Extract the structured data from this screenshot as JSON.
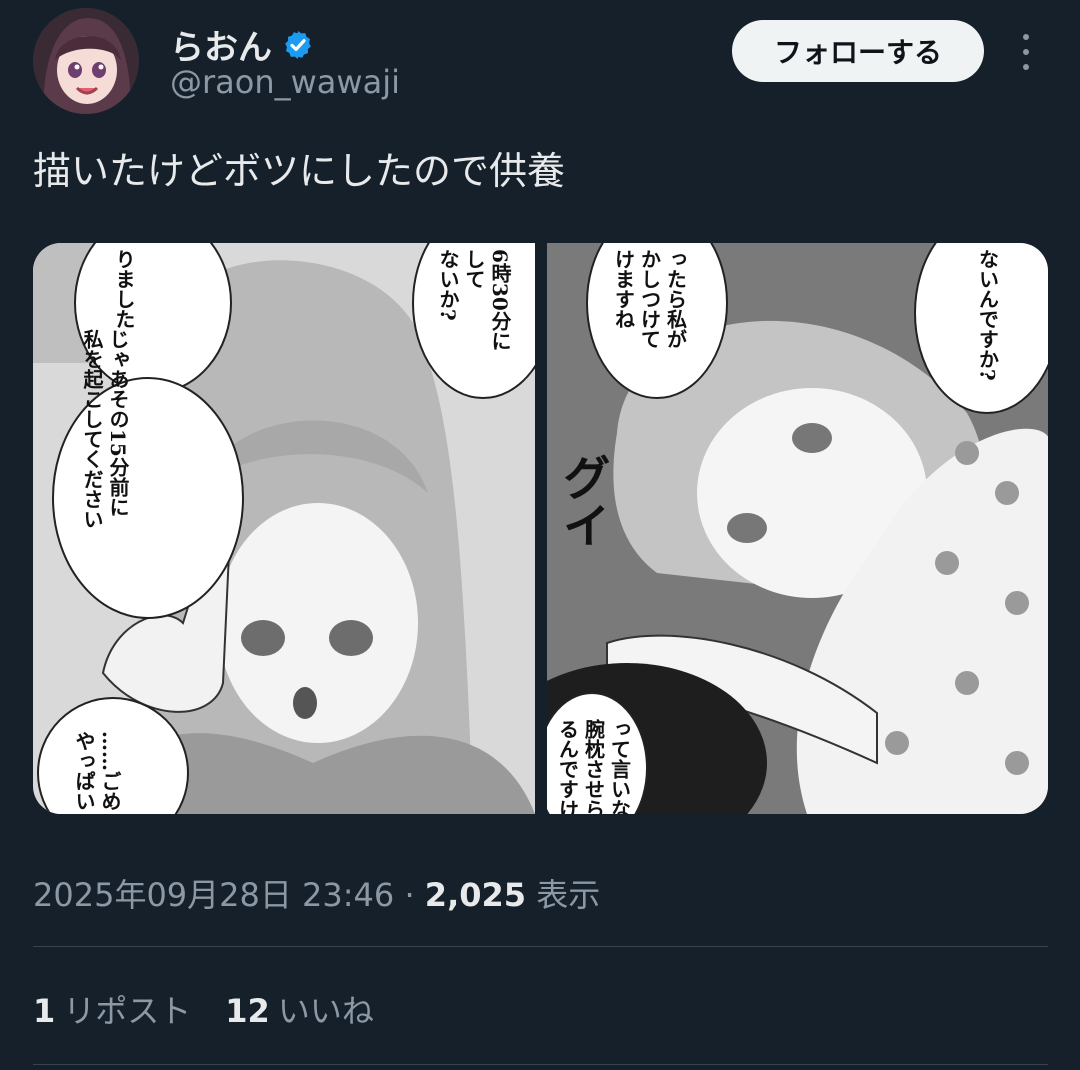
{
  "user": {
    "display_name": "らおん",
    "handle": "@raon_wawaji",
    "verified": true,
    "verified_color": "#1d9bf0",
    "avatar_icon": "avatar"
  },
  "follow_label": "フォローする",
  "more_icon": "more-vertical-icon",
  "tweet_text": "描いたけどボツにしたので供養",
  "media": {
    "left_panel": {
      "bubbles": [
        "りました",
        "じゃあその15分前に\n私を起こしてください",
        "6時30分に\nして\nないか?",
        "……ごめ\nやっぱい"
      ]
    },
    "right_panel": {
      "bubbles": [
        "ったら私が\nかしつけて\nけますね",
        "ないんですか?",
        "って言いな\n腕枕させら\nるんですけ"
      ],
      "sfx": "グイ"
    }
  },
  "meta": {
    "datetime": "2025年09月28日 23:46",
    "separator": "·",
    "views_count": "2,025",
    "views_label": "表示"
  },
  "stats": {
    "reposts_count": "1",
    "reposts_label": "リポスト",
    "likes_count": "12",
    "likes_label": "いいね"
  }
}
